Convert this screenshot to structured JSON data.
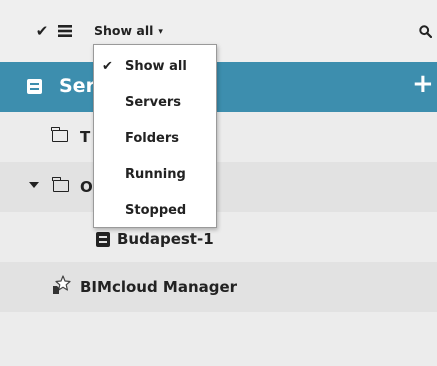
{
  "toolbar": {
    "check_icon": "checkmark-icon",
    "list_icon": "list-icon",
    "filter_label": "Show all",
    "filter_caret": "▾",
    "search_icon": "search-icon"
  },
  "header": {
    "title": "Servers",
    "add_label": "+",
    "accent_color": "#3d8eae"
  },
  "tree": {
    "rows": [
      {
        "label": "T",
        "type": "folder",
        "expanded": false
      },
      {
        "label": "O",
        "type": "folder",
        "expanded": true
      },
      {
        "label": "Budapest-1",
        "type": "server"
      },
      {
        "label": "BIMcloud Manager",
        "type": "manager"
      }
    ]
  },
  "dropdown": {
    "items": [
      {
        "label": "Show all",
        "checked": true
      },
      {
        "label": "Servers",
        "checked": false
      },
      {
        "label": "Folders",
        "checked": false
      },
      {
        "label": "Running",
        "checked": false
      },
      {
        "label": "Stopped",
        "checked": false
      }
    ],
    "check_mark": "✔"
  }
}
